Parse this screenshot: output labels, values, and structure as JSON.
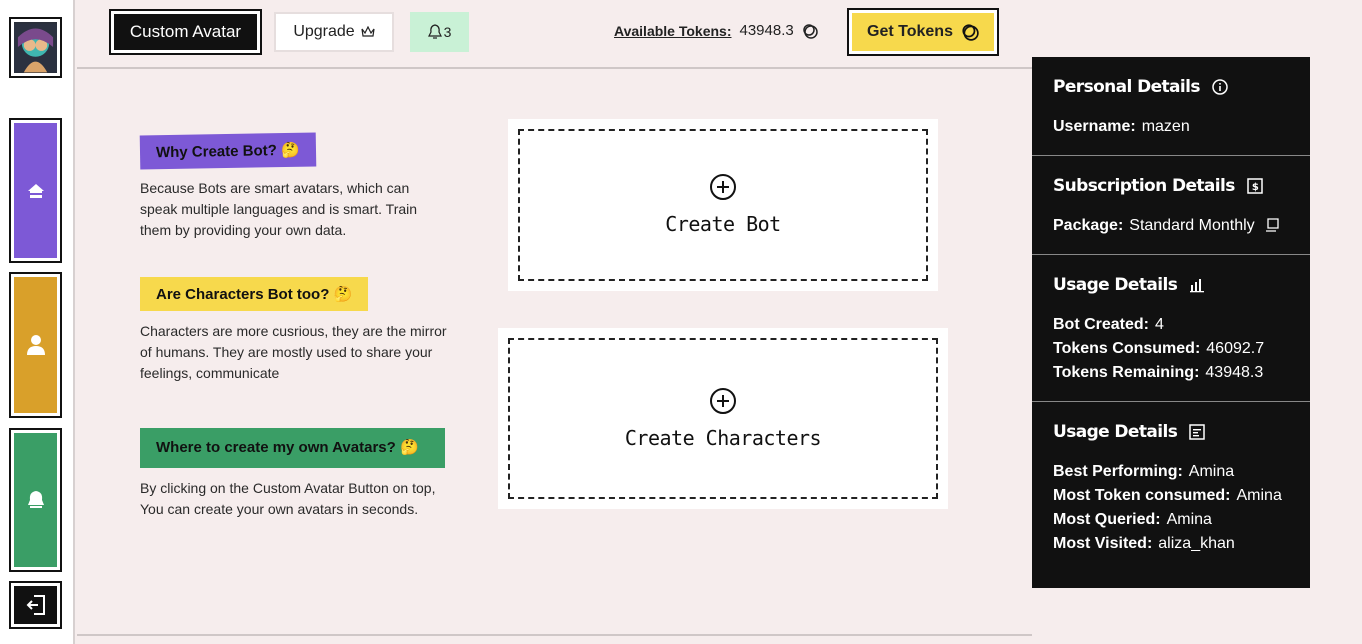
{
  "header": {
    "custom_avatar": "Custom Avatar",
    "upgrade": "Upgrade",
    "notif_count": "3",
    "tokens_label": "Available Tokens:",
    "tokens_value": "43948.3",
    "get_tokens": "Get Tokens"
  },
  "info": [
    {
      "title": "Why Create Bot? 🤔",
      "text": "Because Bots are smart avatars, which can speak multiple languages and is smart. Train them by providing your own data."
    },
    {
      "title": "Are Characters Bot too? 🤔",
      "text": "Characters are more cusrious, they are the mirror of humans. They are mostly used to share your feelings, communicate"
    },
    {
      "title": "Where to create my own Avatars? 🤔",
      "text": "By clicking on the Custom Avatar Button on top, You can create your own avatars in seconds."
    }
  ],
  "cards": {
    "bot": "Create Bot",
    "characters": "Create Characters"
  },
  "panel": {
    "personal": {
      "title": "Personal Details",
      "username_label": "Username:",
      "username": "mazen"
    },
    "subscription": {
      "title": "Subscription Details",
      "package_label": "Package:",
      "package": "Standard Monthly"
    },
    "usage": {
      "title": "Usage Details",
      "bot_label": "Bot Created:",
      "bot": "4",
      "consumed_label": "Tokens Consumed:",
      "consumed": "46092.7",
      "remaining_label": "Tokens Remaining:",
      "remaining": "43948.3"
    },
    "usage2": {
      "title": "Usage Details",
      "best_label": "Best Performing:",
      "best": "Amina",
      "most_token_label": "Most Token consumed:",
      "most_token": "Amina",
      "queried_label": "Most Queried:",
      "queried": "Amina",
      "visited_label": "Most Visited:",
      "visited": "aliza_khan"
    }
  }
}
